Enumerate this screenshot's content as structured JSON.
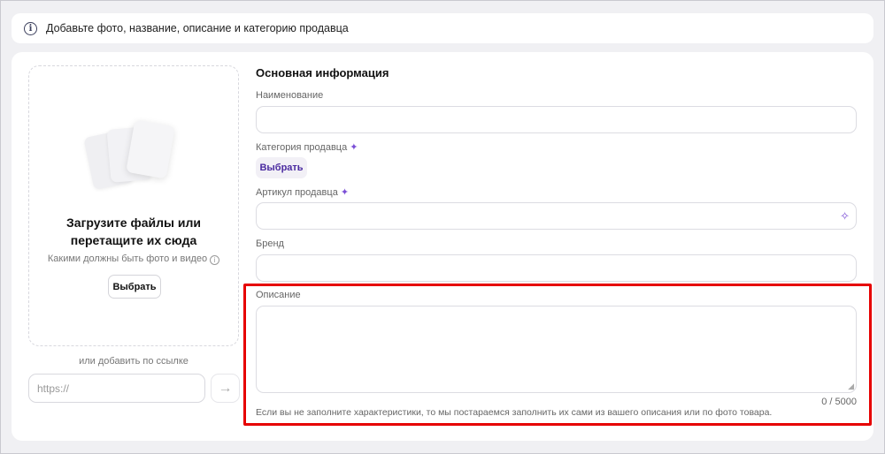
{
  "banner": {
    "text": "Добавьте фото, название, описание и категорию продавца"
  },
  "upload": {
    "title_line1": "Загрузите файлы или",
    "title_line2": "перетащите их сюда",
    "hint": "Какими должны быть фото и видео",
    "button_label": "Выбрать",
    "or_link": "или добавить по ссылке",
    "url_placeholder": "https://"
  },
  "form": {
    "section_title": "Основная информация",
    "name_label": "Наименование",
    "category_label": "Категория продавца",
    "category_button": "Выбрать",
    "article_label": "Артикул продавца",
    "brand_label": "Бренд",
    "description_label": "Описание",
    "description_counter": "0 / 5000",
    "description_hint": "Если вы не заполните характеристики, то мы постараемся заполнить их сами из вашего описания или по фото товара."
  },
  "colors": {
    "accent": "#7b4fd6",
    "highlight": "#e60000"
  }
}
